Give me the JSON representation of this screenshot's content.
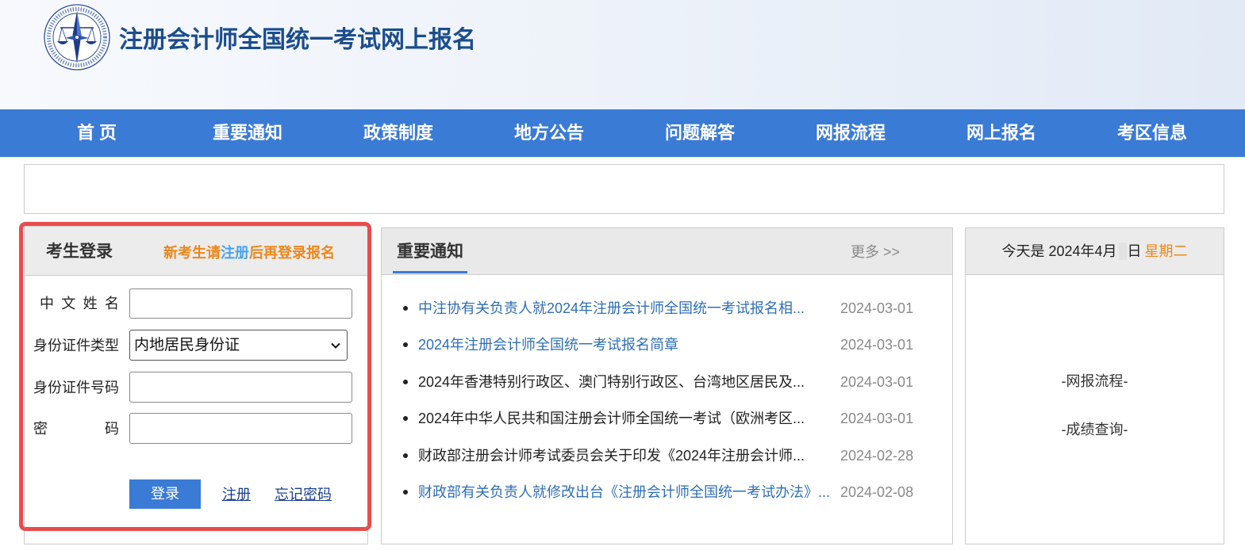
{
  "header": {
    "title": "注册会计师全国统一考试网上报名",
    "logo_icon": "cicpa-emblem-icon"
  },
  "nav": {
    "items": [
      "首 页",
      "重要通知",
      "政策制度",
      "地方公告",
      "问题解答",
      "网报流程",
      "网上报名",
      "考区信息"
    ]
  },
  "login": {
    "title": "考生登录",
    "notice_prefix": "新考生请",
    "notice_link": "注册",
    "notice_suffix": "后再登录报名",
    "name_label": "中 文 姓 名",
    "id_type_label": "身份证件类型",
    "id_type_selected": "内地居民身份证",
    "id_number_label": "身份证件号码",
    "password_label": "密 码",
    "login_button": "登录",
    "register_link": "注册",
    "forgot_link": "忘记密码"
  },
  "notices": {
    "title": "重要通知",
    "more": "更多 >>",
    "items": [
      {
        "text": "中注协有关负责人就2024年注册会计师全国统一考试报名相...",
        "date": "2024-03-01",
        "highlighted": true
      },
      {
        "text": "2024年注册会计师全国统一考试报名简章",
        "date": "2024-03-01",
        "highlighted": true
      },
      {
        "text": "2024年香港特别行政区、澳门特别行政区、台湾地区居民及...",
        "date": "2024-03-01",
        "highlighted": false
      },
      {
        "text": "2024年中华人民共和国注册会计师全国统一考试（欧洲考区...",
        "date": "2024-03-01",
        "highlighted": false
      },
      {
        "text": "财政部注册会计师考试委员会关于印发《2024年注册会计师...",
        "date": "2024-02-28",
        "highlighted": false
      },
      {
        "text": "财政部有关负责人就修改出台《注册会计师全国统一考试办法》...",
        "date": "2024-02-08",
        "highlighted": true
      }
    ]
  },
  "sidebar": {
    "date_prefix": "今天是 2024年4月",
    "date_suffix": "日",
    "weekday": "星期二",
    "links": [
      "-网报流程-",
      "-成绩查询-"
    ]
  },
  "colors": {
    "accent": "#3a7bd5",
    "title": "#1b4d8e",
    "notice_orange": "#f0861a",
    "notice_link_blue": "#4aa3ea",
    "news_link": "#2f6fb5",
    "news_text": "#222222",
    "date_gray": "#8a8a8a",
    "highlight_frame": "#e84c4c"
  }
}
